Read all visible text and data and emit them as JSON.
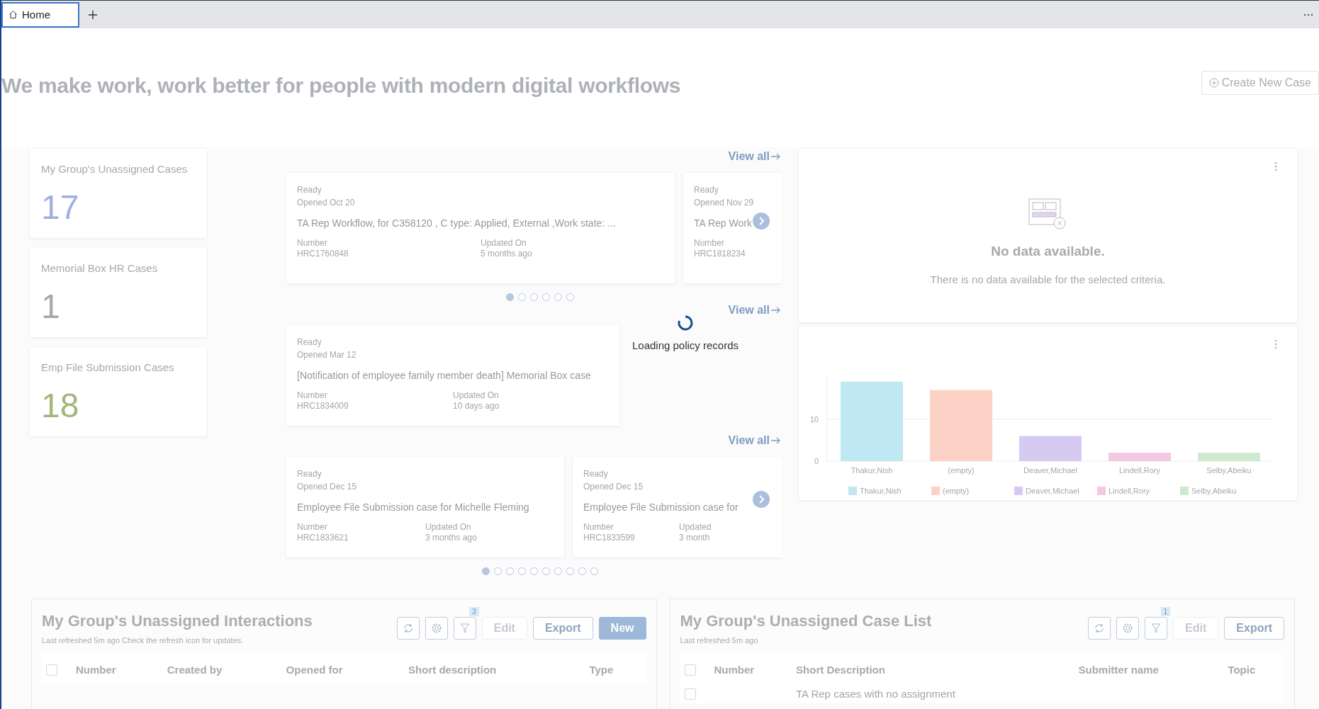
{
  "tabs": [
    {
      "label": "Home",
      "selected": true
    }
  ],
  "headline": "We make work, work better for people with modern digital workflows",
  "create_button": "Create New Case",
  "stat_cards": [
    {
      "title": "My Group's Unassigned Cases",
      "count": "17",
      "color": "#9fb0e0"
    },
    {
      "title": "Memorial Box HR Cases",
      "count": "1",
      "color": "#a8a8a8"
    },
    {
      "title": "Emp File Submission Cases",
      "count": "18",
      "color": "#a3b67c"
    }
  ],
  "carousels": [
    {
      "view_all": "View all",
      "cards": [
        {
          "status": "Ready",
          "opened": "Opened Oct 20",
          "title": "TA Rep Workflow, for C358120 , C type: Applied, External ,Work state: ...",
          "number_label": "Number",
          "number": "HRC1760848",
          "updated_label": "Updated On",
          "updated": "5 months ago"
        },
        {
          "status": "Ready",
          "opened": "Opened Nov 29",
          "title": "TA Rep Work",
          "number_label": "Number",
          "number": "HRC1818234"
        }
      ],
      "next_button": true,
      "dots": [
        {
          "selected": true
        },
        {
          "selected": false
        },
        {
          "selected": false
        },
        {
          "selected": false
        },
        {
          "selected": false
        },
        {
          "selected": false
        }
      ]
    },
    {
      "view_all": "View all",
      "cards": [
        {
          "status": "Ready",
          "opened": "Opened Mar 12",
          "title": "[Notification of employee family member death] Memorial Box case",
          "number_label": "Number",
          "number": "HRC1834009",
          "updated_label": "Updated On",
          "updated": "10 days ago"
        }
      ]
    },
    {
      "view_all": "View all",
      "cards": [
        {
          "status": "Ready",
          "opened": "Opened Dec 15",
          "title": "Employee File Submission case for Michelle Fleming",
          "number_label": "Number",
          "number": "HRC1833621",
          "updated_label": "Updated On",
          "updated": "3 months ago"
        },
        {
          "status": "Ready",
          "opened": "Opened Dec 15",
          "title": "Employee File Submission case for",
          "number_label": "Number",
          "number": "HRC1833599",
          "updated_label": "Updated",
          "updated": "3 month"
        }
      ],
      "next_button": true,
      "dots": [
        {
          "selected": true
        },
        {
          "selected": false
        },
        {
          "selected": false
        },
        {
          "selected": false
        },
        {
          "selected": false
        },
        {
          "selected": false
        },
        {
          "selected": false
        },
        {
          "selected": false
        },
        {
          "selected": false
        },
        {
          "selected": false
        }
      ]
    }
  ],
  "loading": {
    "text": "Loading policy records"
  },
  "empty_panel": {
    "title": "No data available.",
    "message": "There is no data available for the selected criteria."
  },
  "chart_panel": {
    "chart_data": {
      "type": "bar",
      "categories": [
        "Thakur,Nish",
        "(empty)",
        "Deaver,Michael",
        "Lindell,Rory",
        "Selby,Abeiku"
      ],
      "series": [
        {
          "name": "Thakur,Nish",
          "color": "#bfe8f2",
          "values": [
            19,
            null,
            null,
            null,
            null
          ]
        },
        {
          "name": "(empty)",
          "color": "#fcd2c6",
          "values": [
            null,
            17,
            null,
            null,
            null
          ]
        },
        {
          "name": "Deaver,Michael",
          "color": "#d6caf3",
          "values": [
            null,
            null,
            6,
            null,
            null
          ]
        },
        {
          "name": "Lindell,Rory",
          "color": "#f5c8e2",
          "values": [
            null,
            null,
            null,
            2,
            null
          ]
        },
        {
          "name": "Selby,Abeiku",
          "color": "#cfe9cf",
          "values": [
            null,
            null,
            null,
            null,
            2
          ]
        }
      ],
      "yticks": [
        0,
        10
      ],
      "ylim": [
        0,
        20
      ]
    }
  },
  "lists": [
    {
      "title": "My Group's Unassigned Interactions",
      "subtitle": "Last refreshed 5m ago Check the refresh icon for updates.",
      "filter_count": "3",
      "select_all_checked": false,
      "buttons": [
        {
          "label": "Edit",
          "kind": "plain",
          "disabled": true
        },
        {
          "label": "Export",
          "kind": "plain",
          "disabled": false
        },
        {
          "label": "New",
          "kind": "primary",
          "disabled": false
        }
      ],
      "columns": [
        "Number",
        "Created by",
        "Opened for",
        "Short description",
        "Type"
      ]
    },
    {
      "title": "My Group's Unassigned Case List",
      "subtitle": "Last refreshed 5m ago",
      "filter_count": "1",
      "select_all_checked": false,
      "buttons": [
        {
          "label": "Edit",
          "kind": "plain",
          "disabled": true
        },
        {
          "label": "Export",
          "kind": "plain",
          "disabled": false
        }
      ],
      "columns": [
        "Number",
        "Short Description",
        "Submitter name",
        "Topic"
      ],
      "rows": [
        {
          "checked": false,
          "cells": [
            "",
            "TA Rep cases with no assignment",
            "",
            ""
          ]
        }
      ]
    }
  ]
}
